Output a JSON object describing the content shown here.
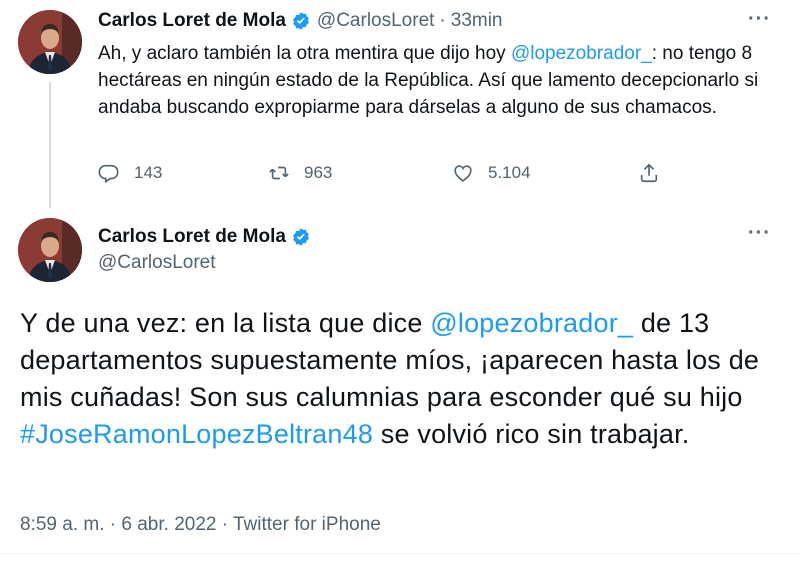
{
  "reply_tweet": {
    "display_name": "Carlos Loret de Mola",
    "handle": "@CarlosLoret",
    "separator": "·",
    "time": "33min",
    "more": "···",
    "text_1": "Ah, y aclaro también la otra mentira que dijo hoy ",
    "mention": "@lopezobrador_",
    "text_2": ": no tengo 8 hectáreas en ningún estado de la República. Así que lamento decepcionarlo si andaba buscando expropiarme para dárselas a alguno de sus chamacos.",
    "replies": "143",
    "retweets": "963",
    "likes": "5.104"
  },
  "main_tweet": {
    "display_name": "Carlos Loret de Mola",
    "handle": "@CarlosLoret",
    "more": "···",
    "text_1": "Y de una vez: en la lista que dice ",
    "mention": "@lopezobrador_",
    "text_2": " de 13 departamentos supuestamente míos, ¡aparecen hasta los de mis cuñadas! Son sus calumnias para esconder qué su hijo ",
    "hashtag": "#JoseRamonLopezBeltran48",
    "text_3": " se volvió rico sin trabajar.",
    "meta": "8:59 a. m. · 6 abr. 2022 · Twitter for iPhone"
  },
  "colors": {
    "link": "#1d9bf0",
    "secondary_text": "#536471",
    "verified": "#1d9bf0"
  }
}
